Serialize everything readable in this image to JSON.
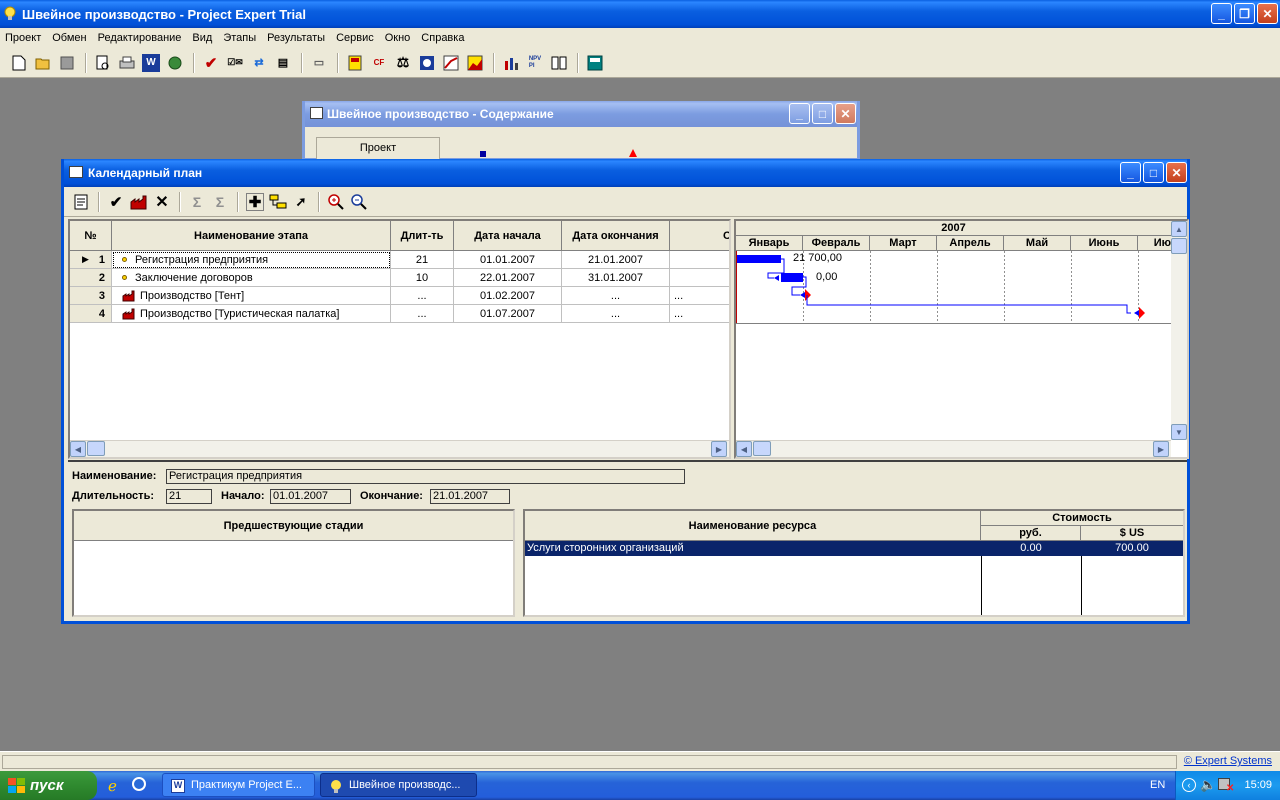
{
  "app": {
    "title": "Швейное производство - Project Expert Trial",
    "menu": [
      "Проект",
      "Обмен",
      "Редактирование",
      "Вид",
      "Этапы",
      "Результаты",
      "Сервис",
      "Окно",
      "Справка"
    ]
  },
  "content_window": {
    "title": "Швейное производство - Содержание",
    "tab_project": "Проект"
  },
  "plan_window": {
    "title": "Календарный план",
    "columns": {
      "num": "№",
      "name": "Наименование этапа",
      "duration": "Длит-ть",
      "start": "Дата начала",
      "end": "Дата окончания",
      "extra": "С"
    },
    "rows": [
      {
        "num": "1",
        "name": "Регистрация предприятия",
        "duration": "21",
        "start": "01.01.2007",
        "end": "21.01.2007",
        "extra": "",
        "icon": "dot-icon",
        "current": true
      },
      {
        "num": "2",
        "name": "Заключение договоров",
        "duration": "10",
        "start": "22.01.2007",
        "end": "31.01.2007",
        "extra": "",
        "icon": "dot-icon",
        "current": false
      },
      {
        "num": "3",
        "name": "Производство [Тент]",
        "duration": "...",
        "start": "01.02.2007",
        "end": "...",
        "extra": "...",
        "icon": "factory-icon",
        "current": false
      },
      {
        "num": "4",
        "name": "Производство [Туристическая палатка]",
        "duration": "...",
        "start": "01.07.2007",
        "end": "...",
        "extra": "...",
        "icon": "factory-icon",
        "current": false
      }
    ],
    "gantt": {
      "year": "2007",
      "months": [
        "Январь",
        "Февраль",
        "Март",
        "Апрель",
        "Май",
        "Июнь",
        "Ию"
      ],
      "bar_labels": [
        "21 700,00",
        "0,00"
      ]
    },
    "details": {
      "name_label": "Наименование:",
      "name_value": "Регистрация предприятия",
      "duration_label": "Длительность:",
      "duration_value": "21",
      "start_label": "Начало:",
      "start_value": "01.01.2007",
      "end_label": "Окончание:",
      "end_value": "21.01.2007",
      "predecessors_header": "Предшествующие стадии",
      "resource_header": "Наименование ресурса",
      "cost_header": "Стоимость",
      "rub_header": "руб.",
      "usd_header": "$ US",
      "resources": [
        {
          "name": "Услуги сторонних организаций",
          "rub": "0.00",
          "usd": "700.00"
        }
      ]
    }
  },
  "statusbar": {
    "brand": "© Expert Systems"
  },
  "taskbar": {
    "start": "пуск",
    "tasks": [
      "Практикум Project E...",
      "Швейное производс..."
    ],
    "lang": "EN",
    "clock": "15:09"
  },
  "colors": {
    "gantt_bar": "#0000ff",
    "link_red": "#ff0000",
    "selection": "#0a246a"
  }
}
